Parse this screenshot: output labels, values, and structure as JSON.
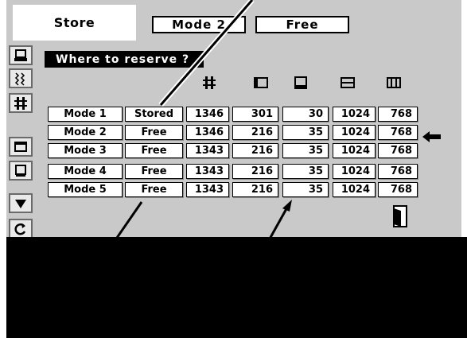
{
  "tabs": {
    "active_label": "Store",
    "mode_label": "Mode 2",
    "free_label": "Free"
  },
  "panel": {
    "title": "Where to reserve ?"
  },
  "table": {
    "column_icons": [
      "total-dots-icon",
      "horizontal-position-icon",
      "vertical-position-icon",
      "display-area-h-icon",
      "display-area-v-icon"
    ],
    "rows": [
      {
        "name": "Mode 1",
        "status": "Stored",
        "values": [
          "1346",
          "301",
          "30",
          "1024",
          "768"
        ]
      },
      {
        "name": "Mode 2",
        "status": "Free",
        "values": [
          "1346",
          "216",
          "35",
          "1024",
          "768"
        ]
      },
      {
        "name": "Mode 3",
        "status": "Free",
        "values": [
          "1343",
          "216",
          "35",
          "1024",
          "768"
        ]
      },
      {
        "name": "Mode 4",
        "status": "Free",
        "values": [
          "1343",
          "216",
          "35",
          "1024",
          "768"
        ]
      },
      {
        "name": "Mode 5",
        "status": "Free",
        "values": [
          "1343",
          "216",
          "35",
          "1024",
          "768"
        ]
      }
    ]
  },
  "sidebar": {
    "icons": [
      "pc-adjust-icon",
      "fine-sync-icon",
      "total-dots-icon",
      "position-icon",
      "display-area-icon",
      "down-arrow-icon",
      "reset-icon"
    ]
  },
  "indicators": {
    "current_row_arrow": "left-arrow-icon",
    "exit_icon": "exit-door-icon"
  },
  "colors": {
    "menu_background": "#c9c9c9",
    "cell_background": "#ffffff",
    "title_bar": "#000000",
    "overlay_cover": "#000000"
  }
}
